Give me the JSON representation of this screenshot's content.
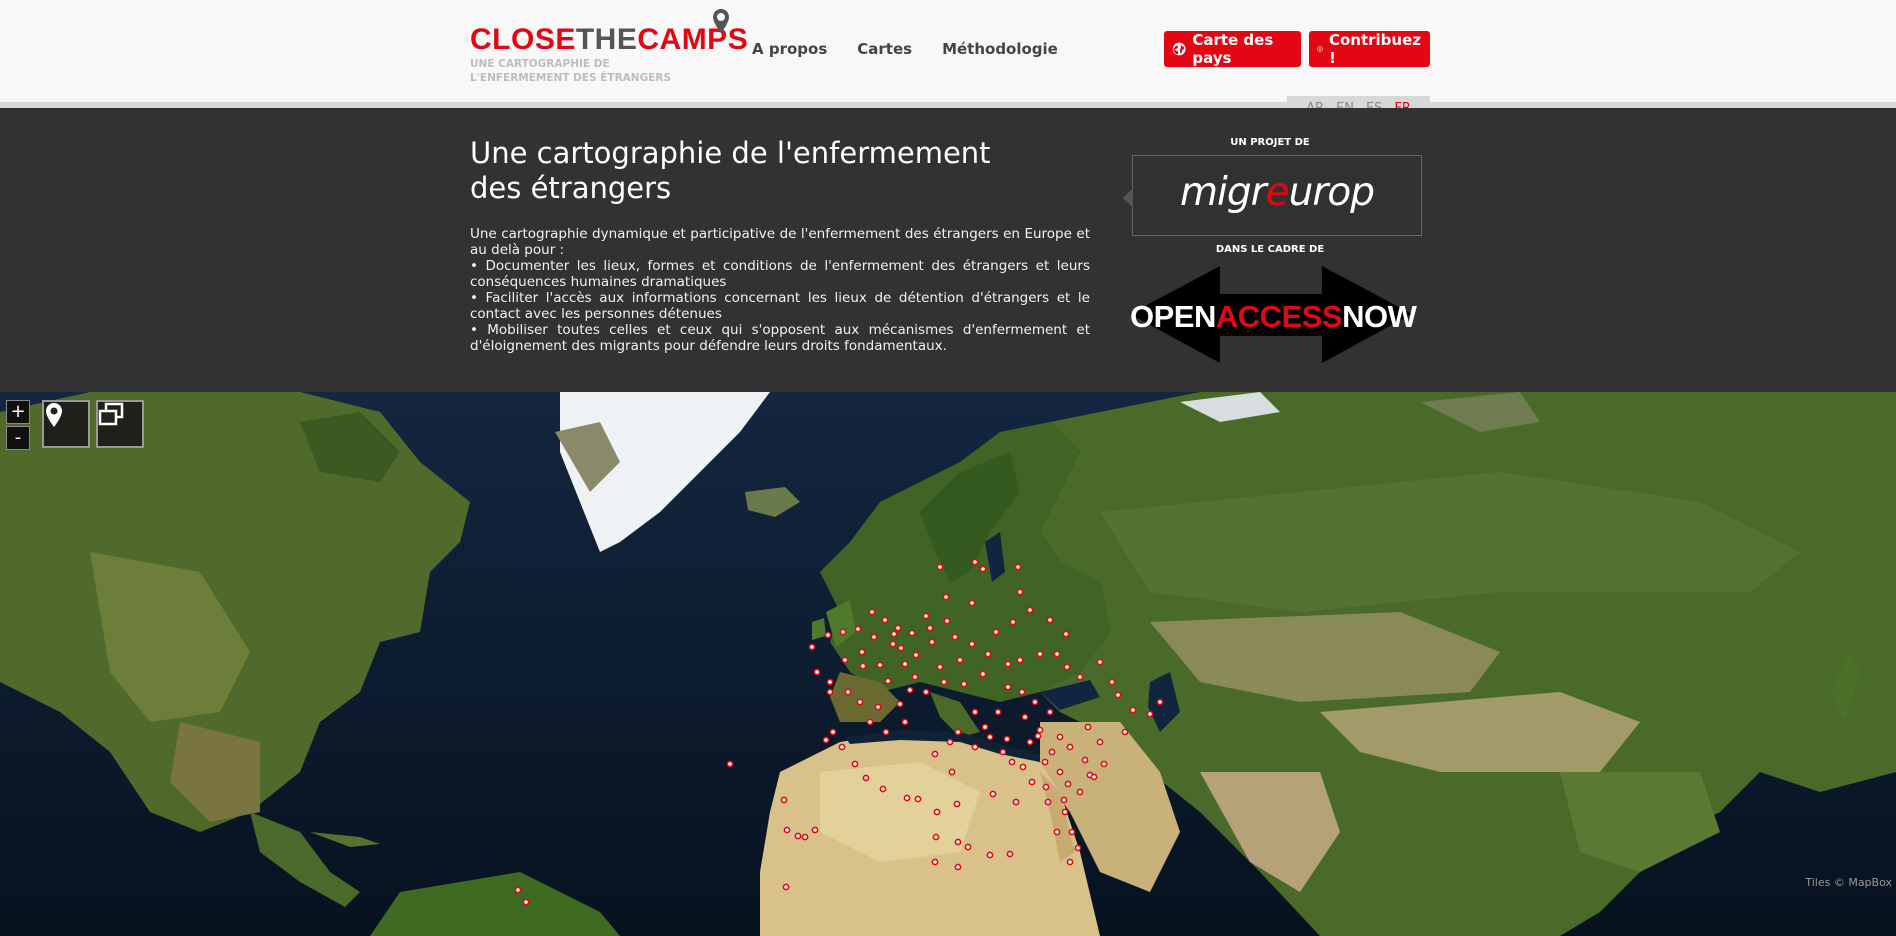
{
  "header": {
    "logo_close": "CLOSE",
    "logo_the": "THE",
    "logo_camps": "CAMPS",
    "logo_sub": "UNE CARTOGRAPHIE DE L'ENFERMEMENT DES ÉTRANGERS",
    "nav": [
      "A propos",
      "Cartes",
      "Méthodologie"
    ],
    "btn_countries": "Carte des pays",
    "btn_contribute": "Contribuez !",
    "languages": [
      "AR",
      "EN",
      "ES",
      "FR"
    ],
    "active_language": "FR"
  },
  "intro": {
    "title": "Une cartographie de l'enfermement des étrangers",
    "lines": [
      "Une cartographie dynamique et participative de l'enfermement des étrangers en Europe et au delà pour :",
      "• Documenter les lieux, formes et conditions de l'enfermement des étrangers et leurs conséquences humaines dramatiques",
      "• Faciliter l'accès aux informations concernant les lieux de détention d'étrangers et le contact avec les personnes détenues",
      "• Mobiliser toutes celles et ceux qui s'opposent aux mécanismes d'enfermement et d'éloignement des migrants pour défendre leurs droits fondamentaux."
    ],
    "project_label": "UN PROJET DE",
    "migreurop": {
      "a": "migr",
      "b": "e",
      "c": "urop"
    },
    "framework_label": "DANS LE CADRE DE",
    "oan": {
      "open": "OPEN",
      "access": "ACCESS",
      "now": "NOW"
    }
  },
  "map": {
    "zoom_in": "+",
    "zoom_out": "-",
    "credit": "Tiles © MapBox",
    "marker_color": "#e30613",
    "icons": [
      "location-pin-icon",
      "layers-icon"
    ]
  }
}
